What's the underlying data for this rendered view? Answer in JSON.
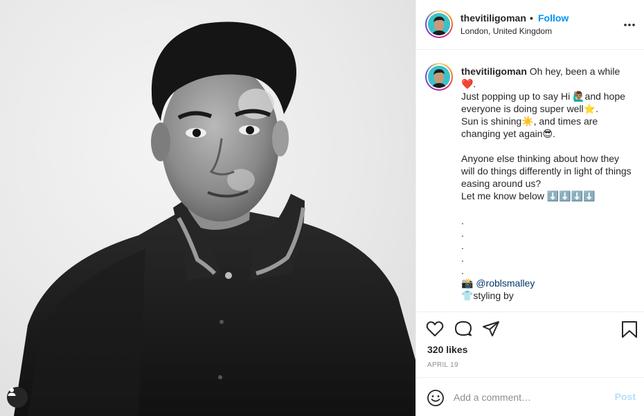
{
  "post": {
    "username": "thevitiligoman",
    "separator": "•",
    "follow_label": "Follow",
    "location": "London, United Kingdom",
    "more_icon": "more-options-icon"
  },
  "caption": {
    "username": "thevitiligoman",
    "lines": [
      " Oh hey, been a while\n❤️.\nJust popping up to say Hi 🙋🏽‍♂️and hope everyone is doing super well⭐️.\nSun is shining☀️, and times are changing yet again😎.\n\nAnyone else thinking about how they will do things differently in light of things easing around us?\nLet me know below ⬇️⬇️⬇️⬇️\n\n.\n.\n.\n.\n.\n📸 "
    ],
    "mention": "@roblsmalley",
    "after_mention": "\n👕styling by"
  },
  "actions": {
    "like_icon": "heart-icon",
    "comment_icon": "comment-icon",
    "share_icon": "share-icon",
    "save_icon": "bookmark-icon",
    "likes": "320 likes",
    "date": "APRIL 19"
  },
  "comment_bar": {
    "emoji_icon": "emoji-icon",
    "placeholder": "Add a comment…",
    "post_label": "Post"
  },
  "photo": {
    "tag_icon": "user-tag-icon"
  },
  "colors": {
    "accent": "#0095f6",
    "post_disabled": "#b2dffc",
    "muted": "#8e8e8e",
    "text": "#262626"
  }
}
